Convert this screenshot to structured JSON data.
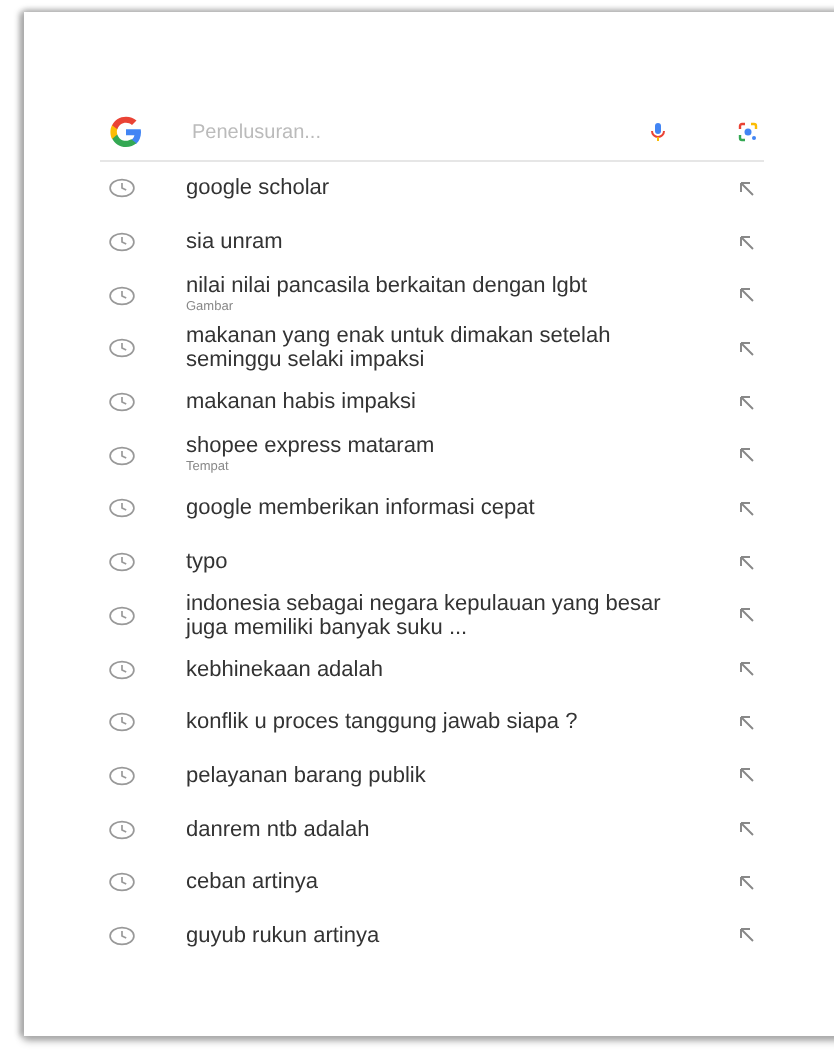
{
  "search": {
    "placeholder": "Penelusuran..."
  },
  "history": [
    {
      "text": "google scholar"
    },
    {
      "text": "sia unram"
    },
    {
      "text": "nilai nilai pancasila berkaitan dengan lgbt",
      "subtitle": "Gambar"
    },
    {
      "text": "makanan yang enak untuk dimakan setelah seminggu selaki impaksi"
    },
    {
      "text": "makanan habis impaksi"
    },
    {
      "text": "shopee express mataram",
      "subtitle": "Tempat"
    },
    {
      "text": "google memberikan informasi cepat"
    },
    {
      "text": "typo"
    },
    {
      "text": "indonesia sebagai negara kepulauan yang besar juga memiliki banyak suku ..."
    },
    {
      "text": "kebhinekaan adalah"
    },
    {
      "text": "konflik u proces tanggung jawab siapa ?"
    },
    {
      "text": "pelayanan barang publik"
    },
    {
      "text": "danrem ntb adalah"
    },
    {
      "text": "ceban artinya"
    },
    {
      "text": "guyub rukun artinya"
    }
  ]
}
